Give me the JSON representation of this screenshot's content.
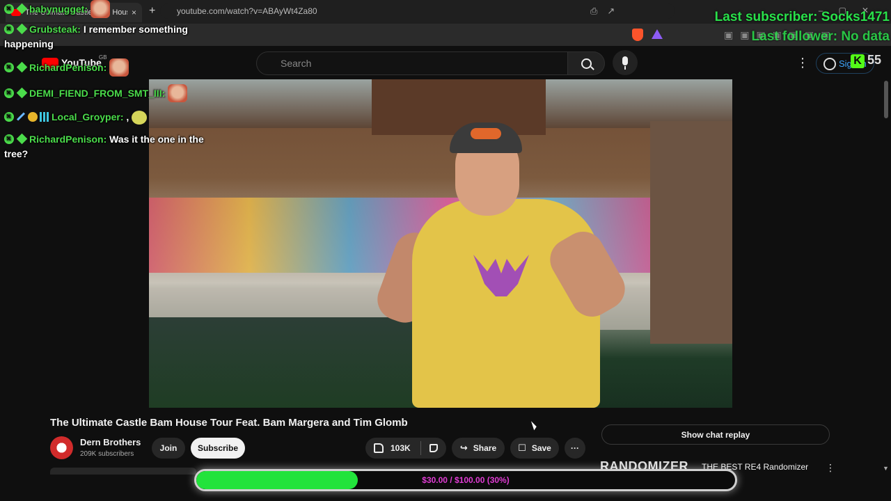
{
  "browser": {
    "tab_title": "The Ultimate Castle Bam House Tour",
    "tab_close": "×",
    "new_tab": "+",
    "url": "youtube.com/watch?v=ABAyWt4Za80"
  },
  "youtube": {
    "logo_text": "YouTube",
    "region": "GB",
    "search_placeholder": "Search",
    "signin_label": "Sign in",
    "menu_glyph": "⋮"
  },
  "video": {
    "title": "The Ultimate Castle Bam House Tour Feat. Bam Margera and Tim Glomb",
    "channel_name": "Dern Brothers",
    "channel_subs": "209K subscribers",
    "join_label": "Join",
    "subscribe_label": "Subscribe",
    "like_count": "103K",
    "share_label": "Share",
    "save_label": "Save",
    "more_glyph": "···",
    "share_glyph": "↪",
    "save_glyph": "☐"
  },
  "sidebar": {
    "show_chat_replay": "Show chat replay",
    "related_title": "RANDOMIZER",
    "related_subtitle": "THE BEST RE4 Randomizer",
    "related_menu_glyph": "⋮"
  },
  "donation": {
    "text": "$30.00 / $100.00 (30%)",
    "progress_percent": 30
  },
  "stream_overlay": {
    "last_subscriber": "Last subscriber: Socks1471",
    "last_follower": "Last follower: No data",
    "kick_logo": "K",
    "viewer_count": "55"
  },
  "chat": [
    {
      "user": "babynugget:",
      "text": ""
    },
    {
      "user": "Grubsteak:",
      "text": "I remember something happening"
    },
    {
      "user": "RichardPenison:",
      "text": ""
    },
    {
      "user": "DEMI_FIEND_FROM_SMT_III:",
      "text": ""
    },
    {
      "user": "Local_Groyper:",
      "text": ","
    },
    {
      "user": "RichardPenison:",
      "text": "Was it the one in the tree?"
    }
  ],
  "colors": {
    "chat_username": "#4bdc4b",
    "overlay_green": "#29e04a",
    "donation_fill": "#22e33b",
    "donation_text": "#e23cd6",
    "kick_green": "#53fc18"
  }
}
